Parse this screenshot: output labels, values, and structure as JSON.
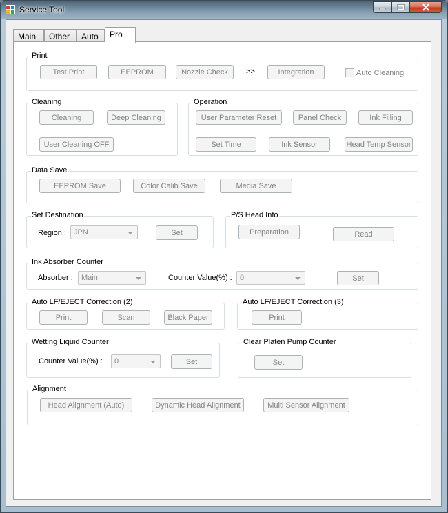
{
  "window": {
    "title": "Service Tool"
  },
  "tabs": [
    {
      "label": "Main"
    },
    {
      "label": "Other"
    },
    {
      "label": "Auto"
    },
    {
      "label": "Pro"
    }
  ],
  "print": {
    "title": "Print",
    "test_print": "Test Print",
    "eeprom": "EEPROM",
    "nozzle_check": "Nozzle Check",
    "arrow": ">>",
    "integration": "Integration",
    "auto_cleaning": "Auto Cleaning",
    "auto_cleaning_checked": false
  },
  "cleaning": {
    "title": "Cleaning",
    "cleaning": "Cleaning",
    "deep_cleaning": "Deep Cleaning",
    "user_cleaning_off": "User Cleaning OFF"
  },
  "operation": {
    "title": "Operation",
    "user_parameter_reset": "User Parameter Reset",
    "panel_check": "Panel Check",
    "ink_filling": "Ink Filling",
    "set_time": "Set Time",
    "ink_sensor": "Ink Sensor",
    "head_temp_sensor": "Head Temp Sensor"
  },
  "data_save": {
    "title": "Data Save",
    "eeprom_save": "EEPROM Save",
    "color_calib_save": "Color Calib Save",
    "media_save": "Media Save"
  },
  "set_destination": {
    "title": "Set Destination",
    "region_label": "Region :",
    "region_value": "JPN",
    "set": "Set"
  },
  "ps_head_info": {
    "title": "P/S Head Info",
    "preparation": "Preparation",
    "read": "Read"
  },
  "ink_absorber": {
    "title": "Ink Absorber Counter",
    "absorber_label": "Absorber :",
    "absorber_value": "Main",
    "counter_label": "Counter Value(%) :",
    "counter_value": "0",
    "set": "Set"
  },
  "auto_lf_2": {
    "title": "Auto LF/EJECT Correction (2)",
    "print": "Print",
    "scan": "Scan",
    "black_paper": "Black Paper"
  },
  "auto_lf_3": {
    "title": "Auto LF/EJECT Correction (3)",
    "print": "Print"
  },
  "wetting": {
    "title": "Wetting Liquid Counter",
    "counter_label": "Counter Value(%) :",
    "counter_value": "0",
    "set": "Set"
  },
  "clear_platen": {
    "title": "Clear Platen Pump Counter",
    "set": "Set"
  },
  "alignment": {
    "title": "Alignment",
    "head_alignment_auto": "Head Alignment (Auto)",
    "dynamic_head_alignment": "Dynamic Head Alignment",
    "multi_sensor_alignment": "Multi Sensor Alignment"
  }
}
